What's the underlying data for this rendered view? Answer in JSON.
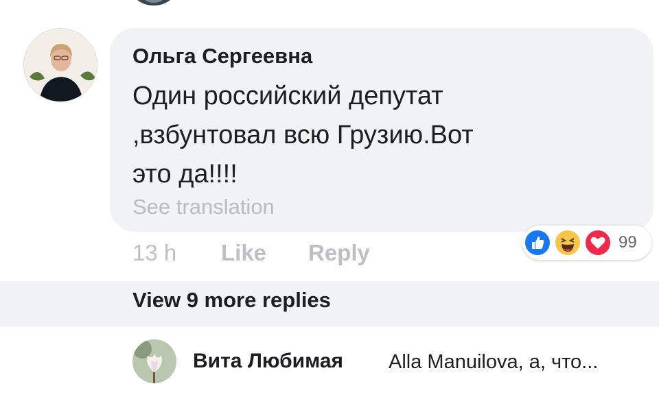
{
  "comment": {
    "author": "Ольга Сергеевна",
    "text": "Один российский депутат ,взбунтовал всю Грузию.Вот это да!!!!",
    "see_translation": "See translation",
    "time": "13 h",
    "like_label": "Like",
    "reply_label": "Reply",
    "reactions": {
      "icons": [
        "like-icon",
        "haha-icon",
        "love-icon"
      ],
      "count": "99",
      "colors": {
        "like": "#1877f2",
        "haha": "#f7c54a",
        "love": "#f0284a"
      }
    }
  },
  "view_more_replies": "View 9 more replies",
  "reply": {
    "author": "Вита Любимая",
    "text": "Alla Manuilova, а, что..."
  },
  "colors": {
    "bubble": "#f0f2f5",
    "text": "#1c1e21",
    "muted": "#bcc0c4"
  }
}
